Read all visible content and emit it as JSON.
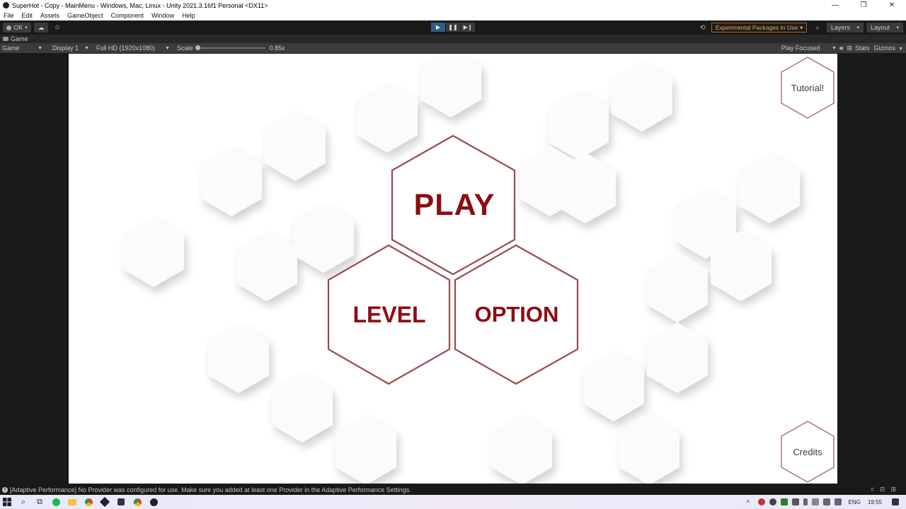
{
  "window": {
    "title": "SuperHot - Copy - MainMenu - Windows, Mac, Linux - Unity 2021.3.16f1 Personal <DX11>",
    "controls": [
      "—",
      "❐",
      "✕"
    ]
  },
  "menu": [
    "File",
    "Edit",
    "Assets",
    "GameObject",
    "Component",
    "Window",
    "Help"
  ],
  "toolbar": {
    "account_label": "OK",
    "experimental_label": "Experimental Packages In Use",
    "layers_label": "Layers",
    "layout_label": "Layout"
  },
  "game_tab": {
    "tab_label": "Game",
    "view_mode": "Game",
    "display": "Display 1",
    "resolution": "Full HD (1920x1080)",
    "scale_label": "Scale",
    "scale_value": "0.85x",
    "play_focus": "Play Focused",
    "stats": "Stats",
    "gizmos": "Gizmos"
  },
  "game_ui": {
    "play": "PLAY",
    "level": "LEVEL",
    "option": "OPTION",
    "tutorial": "Tutorial!",
    "credits": "Credits",
    "accent": "#8b0d12",
    "border": "#a86a6c"
  },
  "status": {
    "message": "[Adaptive Performance] No Provider was configured for use. Make sure you added at least one Provider in the Adaptive Performance Settings."
  },
  "taskbar": {
    "language": "ENG",
    "time": "19:55"
  }
}
